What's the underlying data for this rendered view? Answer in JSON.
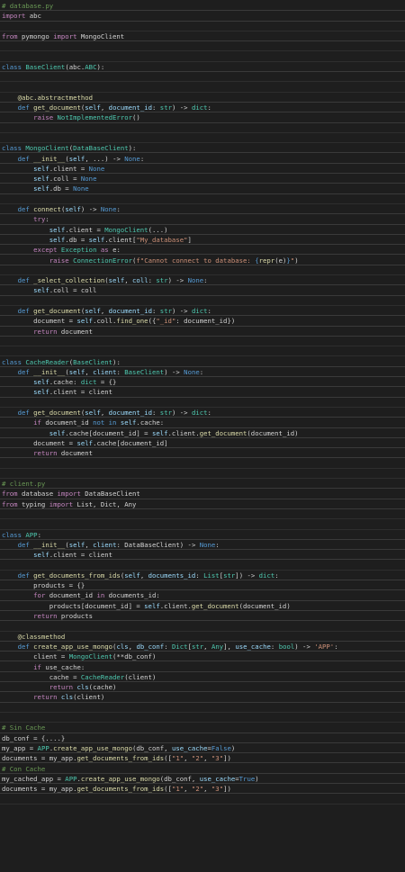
{
  "colors": {
    "background": "#1e1e1e",
    "default": "#d4d4d4",
    "keyword": "#569cd6",
    "control": "#c586c0",
    "type": "#4ec9b0",
    "function": "#dcdcaa",
    "variable": "#9cdcfe",
    "string": "#ce9178",
    "comment": "#6a9955",
    "decorator": "#dcdcaa"
  },
  "lines": [
    [
      [
        "# database.py",
        "comment"
      ]
    ],
    [
      [
        "import",
        "control"
      ],
      [
        " abc",
        "default"
      ]
    ],
    [],
    [
      [
        "from",
        "control"
      ],
      [
        " pymongo ",
        "default"
      ],
      [
        "import",
        "control"
      ],
      [
        " MongoClient",
        "default"
      ]
    ],
    [],
    [],
    [
      [
        "class",
        "keyword"
      ],
      [
        " ",
        "default"
      ],
      [
        "BaseClient",
        "type"
      ],
      [
        "(abc.",
        "default"
      ],
      [
        "ABC",
        "type"
      ],
      [
        "):",
        "default"
      ]
    ],
    [],
    [],
    [
      [
        "    @abc.abstractmethod",
        "decorator"
      ]
    ],
    [
      [
        "    ",
        "default"
      ],
      [
        "def",
        "keyword"
      ],
      [
        " ",
        "default"
      ],
      [
        "get_document",
        "function"
      ],
      [
        "(",
        "default"
      ],
      [
        "self",
        "variable"
      ],
      [
        ", ",
        "default"
      ],
      [
        "document_id",
        "variable"
      ],
      [
        ": ",
        "default"
      ],
      [
        "str",
        "type"
      ],
      [
        ") -> ",
        "default"
      ],
      [
        "dict",
        "type"
      ],
      [
        ":",
        "default"
      ]
    ],
    [
      [
        "        ",
        "default"
      ],
      [
        "raise",
        "control"
      ],
      [
        " ",
        "default"
      ],
      [
        "NotImplementedError",
        "type"
      ],
      [
        "()",
        "default"
      ]
    ],
    [],
    [],
    [
      [
        "class",
        "keyword"
      ],
      [
        " ",
        "default"
      ],
      [
        "MongoClient",
        "type"
      ],
      [
        "(",
        "default"
      ],
      [
        "DataBaseClient",
        "type"
      ],
      [
        "):",
        "default"
      ]
    ],
    [
      [
        "    ",
        "default"
      ],
      [
        "def",
        "keyword"
      ],
      [
        " ",
        "default"
      ],
      [
        "__init__",
        "function"
      ],
      [
        "(",
        "default"
      ],
      [
        "self",
        "variable"
      ],
      [
        ", ...) -> ",
        "default"
      ],
      [
        "None",
        "keyword"
      ],
      [
        ":",
        "default"
      ]
    ],
    [
      [
        "        ",
        "default"
      ],
      [
        "self",
        "variable"
      ],
      [
        ".client = ",
        "default"
      ],
      [
        "None",
        "keyword"
      ]
    ],
    [
      [
        "        ",
        "default"
      ],
      [
        "self",
        "variable"
      ],
      [
        ".coll = ",
        "default"
      ],
      [
        "None",
        "keyword"
      ]
    ],
    [
      [
        "        ",
        "default"
      ],
      [
        "self",
        "variable"
      ],
      [
        ".db = ",
        "default"
      ],
      [
        "None",
        "keyword"
      ]
    ],
    [],
    [
      [
        "    ",
        "default"
      ],
      [
        "def",
        "keyword"
      ],
      [
        " ",
        "default"
      ],
      [
        "connect",
        "function"
      ],
      [
        "(",
        "default"
      ],
      [
        "self",
        "variable"
      ],
      [
        ") -> ",
        "default"
      ],
      [
        "None",
        "keyword"
      ],
      [
        ":",
        "default"
      ]
    ],
    [
      [
        "        ",
        "default"
      ],
      [
        "try",
        "control"
      ],
      [
        ":",
        "default"
      ]
    ],
    [
      [
        "            ",
        "default"
      ],
      [
        "self",
        "variable"
      ],
      [
        ".client = ",
        "default"
      ],
      [
        "MongoClient",
        "type"
      ],
      [
        "(...)",
        "default"
      ]
    ],
    [
      [
        "            ",
        "default"
      ],
      [
        "self",
        "variable"
      ],
      [
        ".db = ",
        "default"
      ],
      [
        "self",
        "variable"
      ],
      [
        ".client[",
        "default"
      ],
      [
        "\"My_database\"",
        "string"
      ],
      [
        "]",
        "default"
      ]
    ],
    [
      [
        "        ",
        "default"
      ],
      [
        "except",
        "control"
      ],
      [
        " ",
        "default"
      ],
      [
        "Exception",
        "type"
      ],
      [
        " ",
        "default"
      ],
      [
        "as",
        "control"
      ],
      [
        " e:",
        "default"
      ]
    ],
    [
      [
        "            ",
        "default"
      ],
      [
        "raise",
        "control"
      ],
      [
        " ",
        "default"
      ],
      [
        "ConnectionError",
        "type"
      ],
      [
        "(",
        "default"
      ],
      [
        "f\"Cannot connect to database: ",
        "string"
      ],
      [
        "{",
        "keyword"
      ],
      [
        "repr",
        "function"
      ],
      [
        "(e)",
        "default"
      ],
      [
        "}",
        "keyword"
      ],
      [
        "\"",
        "string"
      ],
      [
        ")",
        "default"
      ]
    ],
    [],
    [
      [
        "    ",
        "default"
      ],
      [
        "def",
        "keyword"
      ],
      [
        " ",
        "default"
      ],
      [
        "_select_collection",
        "function"
      ],
      [
        "(",
        "default"
      ],
      [
        "self",
        "variable"
      ],
      [
        ", ",
        "default"
      ],
      [
        "coll",
        "variable"
      ],
      [
        ": ",
        "default"
      ],
      [
        "str",
        "type"
      ],
      [
        ") -> ",
        "default"
      ],
      [
        "None",
        "keyword"
      ],
      [
        ":",
        "default"
      ]
    ],
    [
      [
        "        ",
        "default"
      ],
      [
        "self",
        "variable"
      ],
      [
        ".coll = coll",
        "default"
      ]
    ],
    [],
    [
      [
        "    ",
        "default"
      ],
      [
        "def",
        "keyword"
      ],
      [
        " ",
        "default"
      ],
      [
        "get_document",
        "function"
      ],
      [
        "(",
        "default"
      ],
      [
        "self",
        "variable"
      ],
      [
        ", ",
        "default"
      ],
      [
        "document_id",
        "variable"
      ],
      [
        ": ",
        "default"
      ],
      [
        "str",
        "type"
      ],
      [
        ") -> ",
        "default"
      ],
      [
        "dict",
        "type"
      ],
      [
        ":",
        "default"
      ]
    ],
    [
      [
        "        document = ",
        "default"
      ],
      [
        "self",
        "variable"
      ],
      [
        ".coll.",
        "default"
      ],
      [
        "find_one",
        "function"
      ],
      [
        "({",
        "default"
      ],
      [
        "\"_id\"",
        "string"
      ],
      [
        ": document_id})",
        "default"
      ]
    ],
    [
      [
        "        ",
        "default"
      ],
      [
        "return",
        "control"
      ],
      [
        " document",
        "default"
      ]
    ],
    [],
    [],
    [
      [
        "class",
        "keyword"
      ],
      [
        " ",
        "default"
      ],
      [
        "CacheReader",
        "type"
      ],
      [
        "(",
        "default"
      ],
      [
        "BaseClient",
        "type"
      ],
      [
        "):",
        "default"
      ]
    ],
    [
      [
        "    ",
        "default"
      ],
      [
        "def",
        "keyword"
      ],
      [
        " ",
        "default"
      ],
      [
        "__init__",
        "function"
      ],
      [
        "(",
        "default"
      ],
      [
        "self",
        "variable"
      ],
      [
        ", ",
        "default"
      ],
      [
        "client",
        "variable"
      ],
      [
        ": ",
        "default"
      ],
      [
        "BaseClient",
        "type"
      ],
      [
        ") -> ",
        "default"
      ],
      [
        "None",
        "keyword"
      ],
      [
        ":",
        "default"
      ]
    ],
    [
      [
        "        ",
        "default"
      ],
      [
        "self",
        "variable"
      ],
      [
        ".cache: ",
        "default"
      ],
      [
        "dict",
        "type"
      ],
      [
        " = {}",
        "default"
      ]
    ],
    [
      [
        "        ",
        "default"
      ],
      [
        "self",
        "variable"
      ],
      [
        ".client = client",
        "default"
      ]
    ],
    [],
    [
      [
        "    ",
        "default"
      ],
      [
        "def",
        "keyword"
      ],
      [
        " ",
        "default"
      ],
      [
        "get_document",
        "function"
      ],
      [
        "(",
        "default"
      ],
      [
        "self",
        "variable"
      ],
      [
        ", ",
        "default"
      ],
      [
        "document_id",
        "variable"
      ],
      [
        ": ",
        "default"
      ],
      [
        "str",
        "type"
      ],
      [
        ") -> ",
        "default"
      ],
      [
        "dict",
        "type"
      ],
      [
        ":",
        "default"
      ]
    ],
    [
      [
        "        ",
        "default"
      ],
      [
        "if",
        "control"
      ],
      [
        " document_id ",
        "default"
      ],
      [
        "not in",
        "keyword"
      ],
      [
        " ",
        "default"
      ],
      [
        "self",
        "variable"
      ],
      [
        ".cache:",
        "default"
      ]
    ],
    [
      [
        "            ",
        "default"
      ],
      [
        "self",
        "variable"
      ],
      [
        ".cache[document_id] = ",
        "default"
      ],
      [
        "self",
        "variable"
      ],
      [
        ".client.",
        "default"
      ],
      [
        "get_document",
        "function"
      ],
      [
        "(document_id)",
        "default"
      ]
    ],
    [
      [
        "        document = ",
        "default"
      ],
      [
        "self",
        "variable"
      ],
      [
        ".cache[document_id]",
        "default"
      ]
    ],
    [
      [
        "        ",
        "default"
      ],
      [
        "return",
        "control"
      ],
      [
        " document",
        "default"
      ]
    ],
    [],
    [],
    [
      [
        "# client.py",
        "comment"
      ]
    ],
    [
      [
        "from",
        "control"
      ],
      [
        " database ",
        "default"
      ],
      [
        "import",
        "control"
      ],
      [
        " DataBaseClient",
        "default"
      ]
    ],
    [
      [
        "from",
        "control"
      ],
      [
        " typing ",
        "default"
      ],
      [
        "import",
        "control"
      ],
      [
        " List, Dict, Any",
        "default"
      ]
    ],
    [],
    [],
    [
      [
        "class",
        "keyword"
      ],
      [
        " ",
        "default"
      ],
      [
        "APP",
        "type"
      ],
      [
        ":",
        "default"
      ]
    ],
    [
      [
        "    ",
        "default"
      ],
      [
        "def",
        "keyword"
      ],
      [
        " ",
        "default"
      ],
      [
        "__init__",
        "function"
      ],
      [
        "(",
        "default"
      ],
      [
        "self",
        "variable"
      ],
      [
        ", ",
        "default"
      ],
      [
        "client",
        "variable"
      ],
      [
        ": DataBaseClient) -> ",
        "default"
      ],
      [
        "None",
        "keyword"
      ],
      [
        ":",
        "default"
      ]
    ],
    [
      [
        "        ",
        "default"
      ],
      [
        "self",
        "variable"
      ],
      [
        ".client = client",
        "default"
      ]
    ],
    [],
    [
      [
        "    ",
        "default"
      ],
      [
        "def",
        "keyword"
      ],
      [
        " ",
        "default"
      ],
      [
        "get_documents_from_ids",
        "function"
      ],
      [
        "(",
        "default"
      ],
      [
        "self",
        "variable"
      ],
      [
        ", ",
        "default"
      ],
      [
        "documents_id",
        "variable"
      ],
      [
        ": ",
        "default"
      ],
      [
        "List",
        "type"
      ],
      [
        "[",
        "default"
      ],
      [
        "str",
        "type"
      ],
      [
        "]) -> ",
        "default"
      ],
      [
        "dict",
        "type"
      ],
      [
        ":",
        "default"
      ]
    ],
    [
      [
        "        products = {}",
        "default"
      ]
    ],
    [
      [
        "        ",
        "default"
      ],
      [
        "for",
        "control"
      ],
      [
        " document_id ",
        "default"
      ],
      [
        "in",
        "control"
      ],
      [
        " documents_id:",
        "default"
      ]
    ],
    [
      [
        "            products[document_id] = ",
        "default"
      ],
      [
        "self",
        "variable"
      ],
      [
        ".client.",
        "default"
      ],
      [
        "get_document",
        "function"
      ],
      [
        "(document_id)",
        "default"
      ]
    ],
    [
      [
        "        ",
        "default"
      ],
      [
        "return",
        "control"
      ],
      [
        " products",
        "default"
      ]
    ],
    [],
    [
      [
        "    @classmethod",
        "decorator"
      ]
    ],
    [
      [
        "    ",
        "default"
      ],
      [
        "def",
        "keyword"
      ],
      [
        " ",
        "default"
      ],
      [
        "create_app_use_mongo",
        "function"
      ],
      [
        "(",
        "default"
      ],
      [
        "cls",
        "variable"
      ],
      [
        ", ",
        "default"
      ],
      [
        "db_conf",
        "variable"
      ],
      [
        ": ",
        "default"
      ],
      [
        "Dict",
        "type"
      ],
      [
        "[",
        "default"
      ],
      [
        "str",
        "type"
      ],
      [
        ", ",
        "default"
      ],
      [
        "Any",
        "type"
      ],
      [
        "], ",
        "default"
      ],
      [
        "use_cache",
        "variable"
      ],
      [
        ": ",
        "default"
      ],
      [
        "bool",
        "type"
      ],
      [
        ") -> ",
        "default"
      ],
      [
        "'APP'",
        "string"
      ],
      [
        ":",
        "default"
      ]
    ],
    [
      [
        "        client = ",
        "default"
      ],
      [
        "MongoClient",
        "type"
      ],
      [
        "(**db_conf)",
        "default"
      ]
    ],
    [
      [
        "        ",
        "default"
      ],
      [
        "if",
        "control"
      ],
      [
        " use_cache:",
        "default"
      ]
    ],
    [
      [
        "            cache = ",
        "default"
      ],
      [
        "CacheReader",
        "type"
      ],
      [
        "(client)",
        "default"
      ]
    ],
    [
      [
        "            ",
        "default"
      ],
      [
        "return",
        "control"
      ],
      [
        " ",
        "default"
      ],
      [
        "cls",
        "variable"
      ],
      [
        "(cache)",
        "default"
      ]
    ],
    [
      [
        "        ",
        "default"
      ],
      [
        "return",
        "control"
      ],
      [
        " ",
        "default"
      ],
      [
        "cls",
        "variable"
      ],
      [
        "(client)",
        "default"
      ]
    ],
    [],
    [],
    [
      [
        "# Sin Cache",
        "comment"
      ]
    ],
    [
      [
        "db_conf = {....}",
        "default"
      ]
    ],
    [
      [
        "my_app = ",
        "default"
      ],
      [
        "APP",
        "type"
      ],
      [
        ".",
        "default"
      ],
      [
        "create_app_use_mongo",
        "function"
      ],
      [
        "(db_conf, ",
        "default"
      ],
      [
        "use_cache",
        "variable"
      ],
      [
        "=",
        "default"
      ],
      [
        "False",
        "keyword"
      ],
      [
        ")",
        "default"
      ]
    ],
    [
      [
        "documents = my_app.",
        "default"
      ],
      [
        "get_documents_from_ids",
        "function"
      ],
      [
        "([",
        "default"
      ],
      [
        "\"1\"",
        "string"
      ],
      [
        ", ",
        "default"
      ],
      [
        "\"2\"",
        "string"
      ],
      [
        ", ",
        "default"
      ],
      [
        "\"3\"",
        "string"
      ],
      [
        "])",
        "default"
      ]
    ],
    [
      [
        "# Con Cache",
        "comment"
      ]
    ],
    [
      [
        "my_cached_app = ",
        "default"
      ],
      [
        "APP",
        "type"
      ],
      [
        ".",
        "default"
      ],
      [
        "create_app_use_mongo",
        "function"
      ],
      [
        "(db_conf, ",
        "default"
      ],
      [
        "use_cache",
        "variable"
      ],
      [
        "=",
        "default"
      ],
      [
        "True",
        "keyword"
      ],
      [
        ")",
        "default"
      ]
    ],
    [
      [
        "documents = my_app.",
        "default"
      ],
      [
        "get_documents_from_ids",
        "function"
      ],
      [
        "([",
        "default"
      ],
      [
        "\"1\"",
        "string"
      ],
      [
        ", ",
        "default"
      ],
      [
        "\"2\"",
        "string"
      ],
      [
        ", ",
        "default"
      ],
      [
        "\"3\"",
        "string"
      ],
      [
        "])",
        "default"
      ]
    ],
    []
  ]
}
